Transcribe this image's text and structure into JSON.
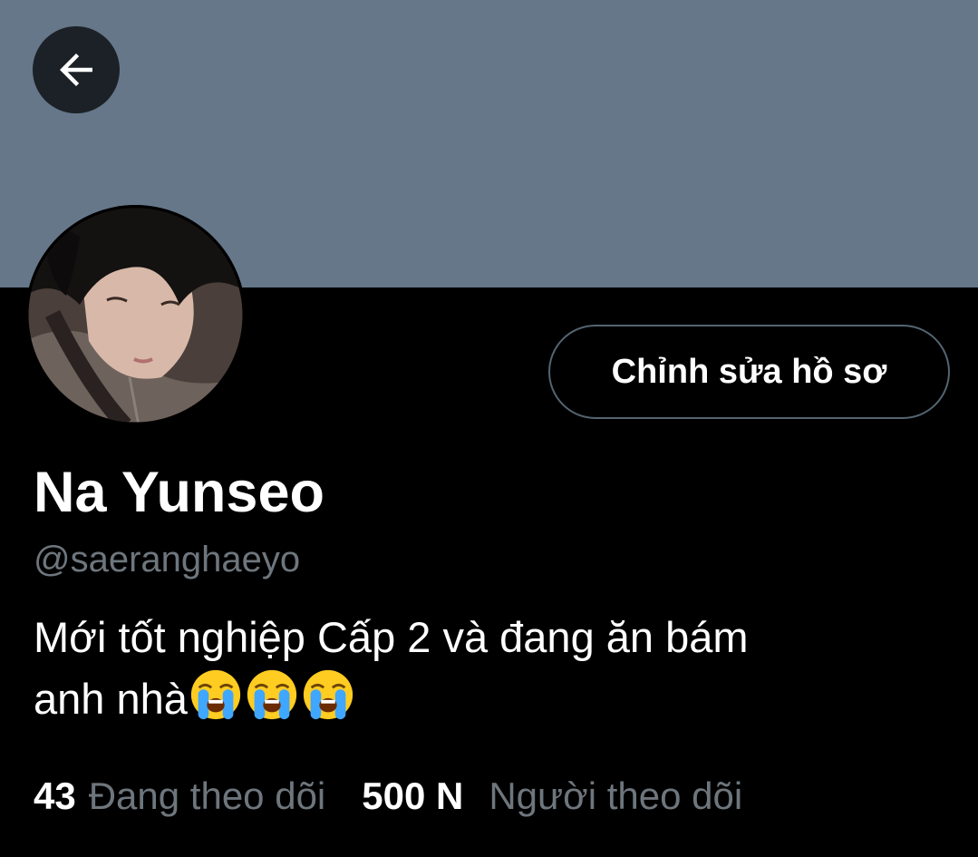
{
  "banner": {
    "color": "#66778a"
  },
  "header": {
    "back_icon": "arrow-left-icon"
  },
  "profile": {
    "edit_button_label": "Chỉnh sửa hồ sơ",
    "display_name": "Na Yunseo",
    "handle": "@saeranghaeyo",
    "bio_line1": "Mới tốt nghiệp Cấp 2 và đang ăn bám",
    "bio_line2": "anh nhà",
    "bio_emojis": [
      "loudly-crying-face-emoji",
      "loudly-crying-face-emoji",
      "loudly-crying-face-emoji"
    ]
  },
  "stats": {
    "following_count": "43",
    "following_label": "Đang theo dõi",
    "followers_count": "500 N",
    "followers_label": "Người theo dõi"
  },
  "colors": {
    "background": "#000000",
    "secondary_text": "#6e767d",
    "button_border": "#536471"
  }
}
